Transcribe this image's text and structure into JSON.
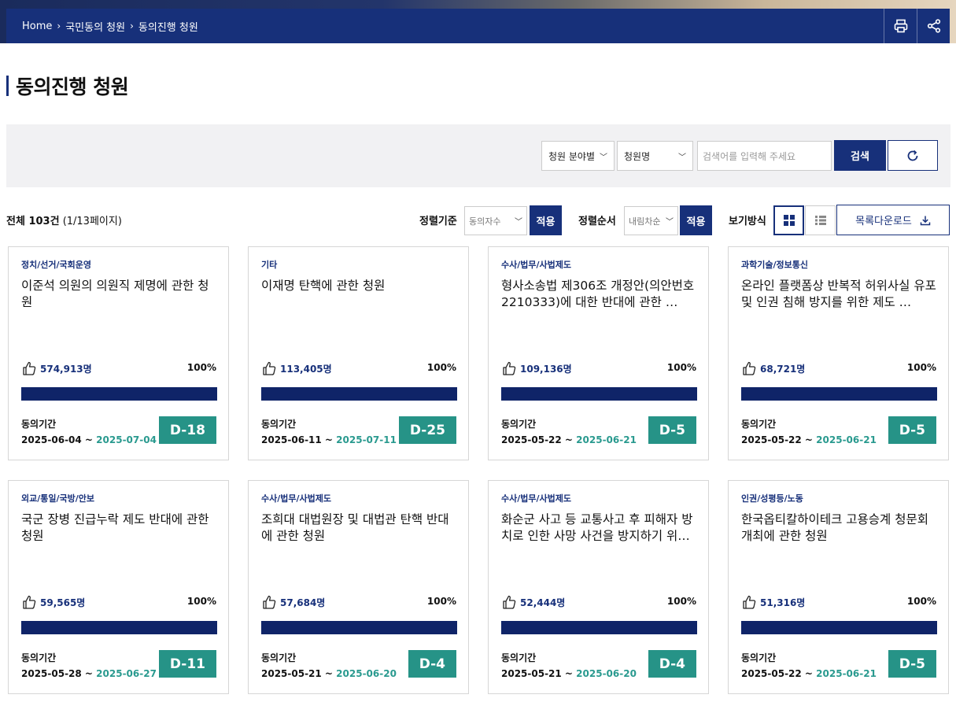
{
  "breadcrumb": [
    "Home",
    "국민동의 청원",
    "동의진행 청원"
  ],
  "header_actions": [
    {
      "name": "print",
      "icon": "printer-icon"
    },
    {
      "name": "share",
      "icon": "share-icon"
    }
  ],
  "page_title": "동의진행 청원",
  "search": {
    "category_select": "청원 분야별",
    "field_select": "청원명",
    "placeholder": "검색어를 입력해 주세요",
    "search_button": "검색",
    "reset_icon": "refresh-icon"
  },
  "toolbar": {
    "total_label": "전체 103건",
    "page_info": "(1/13페이지)",
    "sort_key_label": "정렬기준",
    "sort_key_value": "동의자수",
    "sort_order_label": "정렬순서",
    "sort_order_value": "내림차순",
    "apply_label": "적용",
    "view_label": "보기방식",
    "view_mode": "grid",
    "download_label": "목록다운로드"
  },
  "colors": {
    "primary": "#17307a",
    "accent_teal": "#269387",
    "date_teal": "#2a9a8f",
    "panel_bg": "#f1f1f3"
  },
  "cards": [
    {
      "category": "정치/선거/국회운영",
      "title": "이준석 의원의 의원직 제명에 관한 청원",
      "likes": "574,913명",
      "percent": "100%",
      "progress": 1.0,
      "period_label": "동의기간",
      "start": "2025-06-04 ~ ",
      "end": "2025-07-04",
      "dday": "D-18"
    },
    {
      "category": "기타",
      "title": "이재명 탄핵에 관한 청원",
      "likes": "113,405명",
      "percent": "100%",
      "progress": 1.0,
      "period_label": "동의기간",
      "start": "2025-06-11 ~ ",
      "end": "2025-07-11",
      "dday": "D-25"
    },
    {
      "category": "수사/법무/사법제도",
      "title": "형사소송법 제306조 개정안(의안번호 2210333)에 대한 반대에 관한 …",
      "likes": "109,136명",
      "percent": "100%",
      "progress": 1.0,
      "period_label": "동의기간",
      "start": "2025-05-22 ~ ",
      "end": "2025-06-21",
      "dday": "D-5"
    },
    {
      "category": "과학기술/정보통신",
      "title": "온라인 플랫폼상 반복적 허위사실 유포 및 인권 침해 방지를 위한 제도 …",
      "likes": "68,721명",
      "percent": "100%",
      "progress": 1.0,
      "period_label": "동의기간",
      "start": "2025-05-22 ~ ",
      "end": "2025-06-21",
      "dday": "D-5"
    },
    {
      "category": "외교/통일/국방/안보",
      "title": "국군 장병 진급누락 제도 반대에 관한 청원",
      "likes": "59,565명",
      "percent": "100%",
      "progress": 1.0,
      "period_label": "동의기간",
      "start": "2025-05-28 ~ ",
      "end": "2025-06-27",
      "dday": "D-11"
    },
    {
      "category": "수사/법무/사법제도",
      "title": "조희대 대법원장 및 대법관 탄핵 반대에 관한 청원",
      "likes": "57,684명",
      "percent": "100%",
      "progress": 1.0,
      "period_label": "동의기간",
      "start": "2025-05-21 ~ ",
      "end": "2025-06-20",
      "dday": "D-4"
    },
    {
      "category": "수사/법무/사법제도",
      "title": "화순군 사고 등 교통사고 후 피해자 방치로 인한 사망 사건을 방지하기 위…",
      "likes": "52,444명",
      "percent": "100%",
      "progress": 1.0,
      "period_label": "동의기간",
      "start": "2025-05-21 ~ ",
      "end": "2025-06-20",
      "dday": "D-4"
    },
    {
      "category": "인권/성평등/노동",
      "title": "한국옵티칼하이테크 고용승계 청문회 개최에 관한 청원",
      "likes": "51,316명",
      "percent": "100%",
      "progress": 1.0,
      "period_label": "동의기간",
      "start": "2025-05-22 ~ ",
      "end": "2025-06-21",
      "dday": "D-5"
    }
  ]
}
